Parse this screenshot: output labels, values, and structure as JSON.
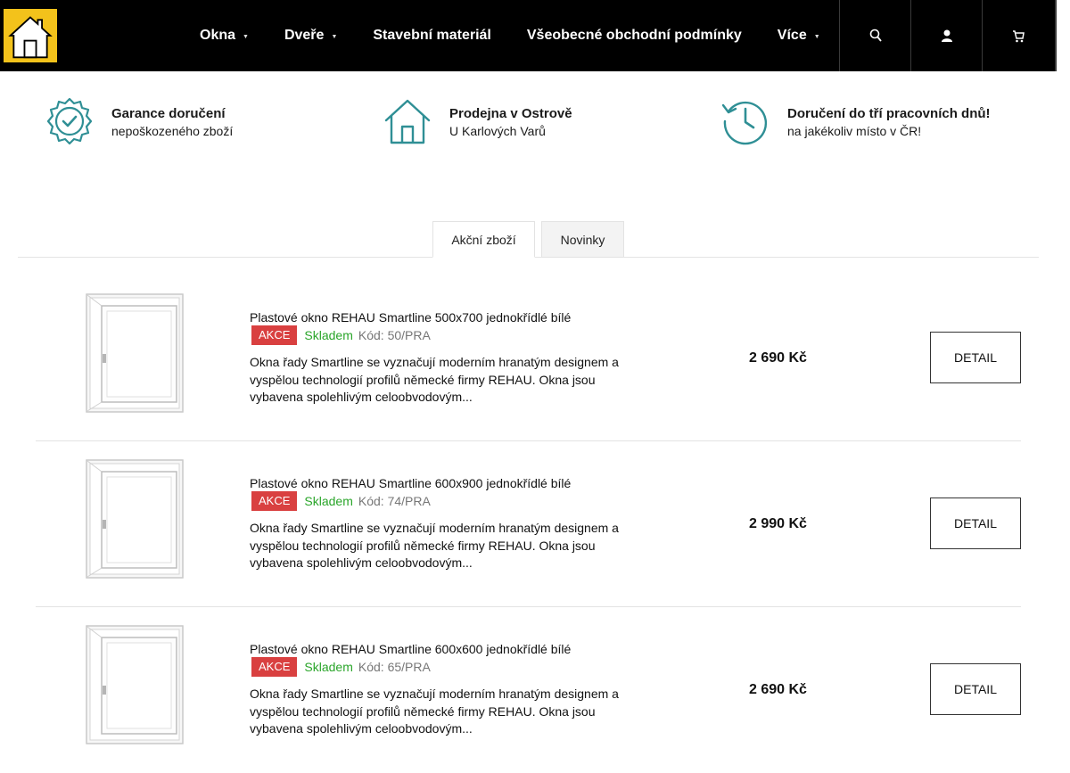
{
  "header": {
    "nav": [
      {
        "label": "Okna",
        "has_dropdown": true
      },
      {
        "label": "Dveře",
        "has_dropdown": true
      },
      {
        "label": "Stavební materiál",
        "has_dropdown": false
      },
      {
        "label": "Všeobecné obchodní podmínky",
        "has_dropdown": false
      },
      {
        "label": "Více",
        "has_dropdown": true
      }
    ],
    "icons": [
      "search-icon",
      "user-icon",
      "cart-icon"
    ],
    "accent_color": "#f3c21b",
    "background": "#000000"
  },
  "benefits": [
    {
      "title": "Garance doručení",
      "subtitle": "nepoškozeného zboží",
      "icon": "badge-check-icon"
    },
    {
      "title": "Prodejna v Ostrově",
      "subtitle": "U Karlových Varů",
      "icon": "house-icon"
    },
    {
      "title": "Doručení do tří pracovních dnů!",
      "subtitle": "na jakékoliv místo v ČR!",
      "icon": "history-clock-icon"
    }
  ],
  "tabs": [
    {
      "label": "Akční zboží",
      "active": true
    },
    {
      "label": "Novinky",
      "active": false
    }
  ],
  "products": [
    {
      "name": "Plastové okno REHAU Smartline 500x700 jednokřídlé bílé",
      "badge": "AKCE",
      "stock": "Skladem",
      "code": "Kód: 50/PRA",
      "description": "Okna řady Smartline se vyznačují moderním hranatým designem a vyspělou technologií profilů německé firmy REHAU. Okna jsou vybavena spolehlivým celoobvodovým...",
      "price": "2 690 Kč",
      "button": "DETAIL"
    },
    {
      "name": "Plastové okno REHAU Smartline 600x900 jednokřídlé bílé",
      "badge": "AKCE",
      "stock": "Skladem",
      "code": "Kód: 74/PRA",
      "description": "Okna řady Smartline se vyznačují moderním hranatým designem a vyspělou technologií profilů německé firmy REHAU. Okna jsou vybavena spolehlivým celoobvodovým...",
      "price": "2 990 Kč",
      "button": "DETAIL"
    },
    {
      "name": "Plastové okno REHAU Smartline 600x600 jednokřídlé bílé",
      "badge": "AKCE",
      "stock": "Skladem",
      "code": "Kód: 65/PRA",
      "description": "Okna řady Smartline se vyznačují moderním hranatým designem a vyspělou technologií profilů německé firmy REHAU. Okna jsou vybavena spolehlivým celoobvodovým...",
      "price": "2 690 Kč",
      "button": "DETAIL"
    }
  ],
  "colors": {
    "badge": "#d94040",
    "in_stock": "#2aa52a",
    "icon_teal": "#2f8f95"
  }
}
